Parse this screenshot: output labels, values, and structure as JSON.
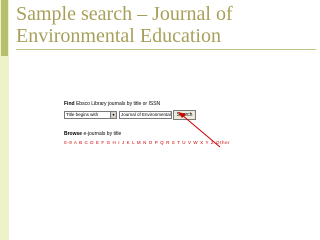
{
  "slide": {
    "title_line1": "Sample search – Journal of",
    "title_line2": "Environmental Education"
  },
  "find": {
    "heading": "Find",
    "description": "Ebsco Library journals by title or ISSN"
  },
  "search": {
    "select_value": "Title begins with",
    "input_value": "Journal of Environmental",
    "button_label": "Search"
  },
  "browse": {
    "heading": "Browse",
    "description": "e-journals by title",
    "letters": "0-9 A B C D E F G H I J K L M N O P Q R S T U V W X Y Z Other"
  },
  "colors": {
    "title": "#a8a05a",
    "accent_bar": "#b7bf6e",
    "arrow": "#cc0000",
    "links": "#cc0000"
  }
}
